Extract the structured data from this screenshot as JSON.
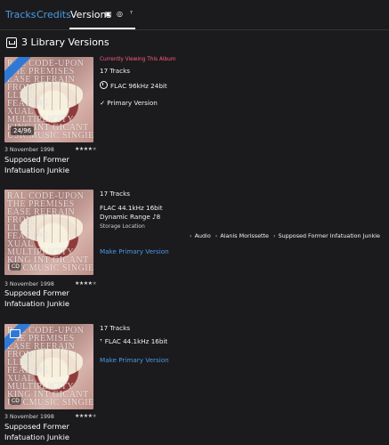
{
  "tabs": {
    "tracks": "Tracks",
    "credits": "Credits",
    "versions": "Versions"
  },
  "section": {
    "title": "3 Library Versions"
  },
  "versions": [
    {
      "date": "3 November 1998",
      "title": "Supposed Former Infatuation Junkie",
      "stars_filled": "★★★★",
      "stars_empty": "★",
      "current": "Currently Viewing This Album",
      "tracks": "17 Tracks",
      "format": "FLAC 96kHz 24bit",
      "primary": "✓ Primary Version",
      "badge": "24/96"
    },
    {
      "date": "3 November 1998",
      "title": "Supposed Former Infatuation Junkie",
      "stars_filled": "★★★★",
      "stars_empty": "★",
      "tracks": "17 Tracks",
      "format": "FLAC 44.1kHz 16bit",
      "dynamic_range": "Dynamic Range ♪8",
      "storage": "Storage Location",
      "action": "Make Primary Version",
      "badge": "CD"
    },
    {
      "date": "3 November 1998",
      "title": "Supposed Former Infatuation Junkie",
      "stars_filled": "★★★★",
      "stars_empty": "★",
      "tracks": "17 Tracks",
      "format": "FLAC 44.1kHz 16bit",
      "action": "Make Primary Version",
      "badge": "CD"
    }
  ],
  "path": {
    "part1": "Audio",
    "part2": "Alanis Morissette",
    "part3": "Supposed Former Infatuation Junkie"
  },
  "cover_text": "RAL CODE-UPON\nTHE PREMISES\nEASE REFRAIN FROM\nLLING\nFEADING\nXUAL MULTIPLICITY\nKING INT GICANT\nUSICMUSIC SINGIE"
}
